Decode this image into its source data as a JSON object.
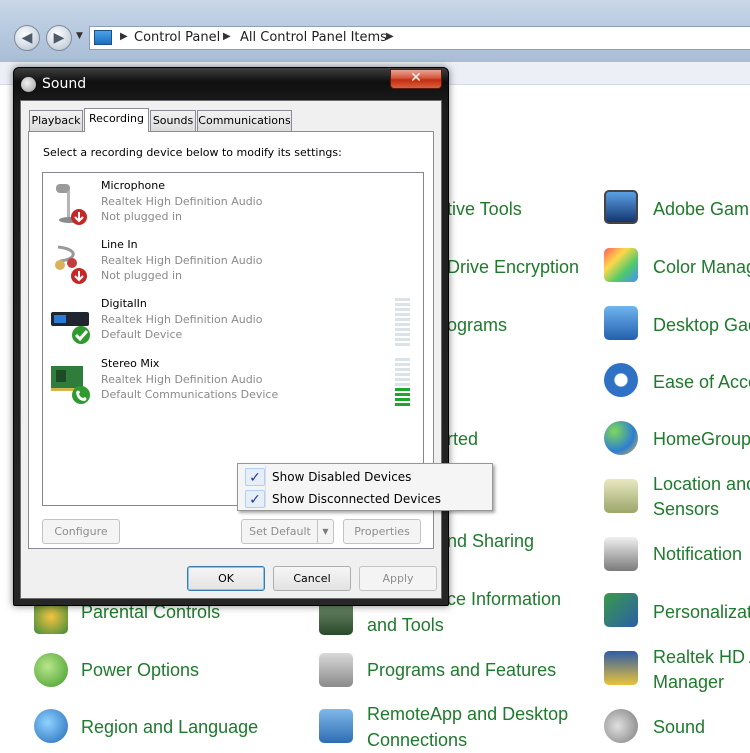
{
  "explorer": {
    "breadcrumb": [
      "Control Panel",
      "All Control Panel Items"
    ],
    "items": [
      {
        "label": "tive Tools",
        "icon": "tools-icon"
      },
      {
        "label": "Drive Encryption",
        "icon": "bitlocker-icon"
      },
      {
        "label": "ograms",
        "icon": "programs-icon"
      },
      {
        "label": "rted",
        "icon": "getting-started-icon"
      },
      {
        "label": "nd Sharing",
        "icon": "network-icon"
      },
      {
        "label": "ce Information",
        "label2": "and Tools",
        "icon": "performance-icon"
      },
      {
        "label": "Parental Controls",
        "icon": "parental-controls-icon"
      },
      {
        "label": "Power Options",
        "icon": "power-options-icon"
      },
      {
        "label": "Programs and Features",
        "icon": "programs-features-icon"
      },
      {
        "label": "Region and Language",
        "icon": "globe-icon"
      },
      {
        "label": "RemoteApp and Desktop",
        "label2": "Connections",
        "icon": "remoteapp-icon"
      },
      {
        "label": "Adobe Gam",
        "icon": "monitor-icon"
      },
      {
        "label": "Color Manag",
        "icon": "color-management-icon"
      },
      {
        "label": "Desktop Gad",
        "icon": "desktop-gadgets-icon"
      },
      {
        "label": "Ease of Acce",
        "icon": "ease-of-access-icon"
      },
      {
        "label": "HomeGroup",
        "icon": "homegroup-icon"
      },
      {
        "label": "Location and",
        "label2": "Sensors",
        "icon": "location-icon"
      },
      {
        "label": "Notification",
        "icon": "notification-icon"
      },
      {
        "label": "Personalizat",
        "icon": "personalization-icon"
      },
      {
        "label": "Realtek HD A",
        "label2": "Manager",
        "icon": "realtek-icon"
      },
      {
        "label": "Sound",
        "icon": "speaker-icon"
      }
    ]
  },
  "dialog": {
    "title": "Sound",
    "close_label": "✕",
    "tabs": [
      "Playback",
      "Recording",
      "Sounds",
      "Communications"
    ],
    "active_tab": "Recording",
    "instruction": "Select a recording device below to modify its settings:",
    "devices": [
      {
        "name": "Microphone",
        "driver": "Realtek High Definition Audio",
        "status": "Not plugged in",
        "icon": "microphone-icon",
        "badge": "unplugged-badge-icon"
      },
      {
        "name": "Line In",
        "driver": "Realtek High Definition Audio",
        "status": "Not plugged in",
        "icon": "line-in-icon",
        "badge": "unplugged-badge-icon"
      },
      {
        "name": "DigitalIn",
        "driver": "Realtek High Definition Audio",
        "status": "Default Device",
        "icon": "digital-in-icon",
        "badge": "default-check-icon",
        "level": 0
      },
      {
        "name": "Stereo Mix",
        "driver": "Realtek High Definition Audio",
        "status": "Default Communications Device",
        "icon": "stereo-mix-icon",
        "badge": "communications-phone-icon",
        "level": 0.4
      }
    ],
    "buttons": {
      "configure": "Configure",
      "set_default": "Set Default",
      "properties": "Properties",
      "ok": "OK",
      "cancel": "Cancel",
      "apply": "Apply"
    }
  },
  "context_menu": {
    "items": [
      {
        "label": "Show Disabled Devices",
        "checked": true
      },
      {
        "label": "Show Disconnected Devices",
        "checked": true
      }
    ],
    "check_glyph": "✓"
  },
  "colors": {
    "link_green": "#1e7a2c",
    "meter_on": "#20a531",
    "title_bar": "#1d1d1d"
  }
}
